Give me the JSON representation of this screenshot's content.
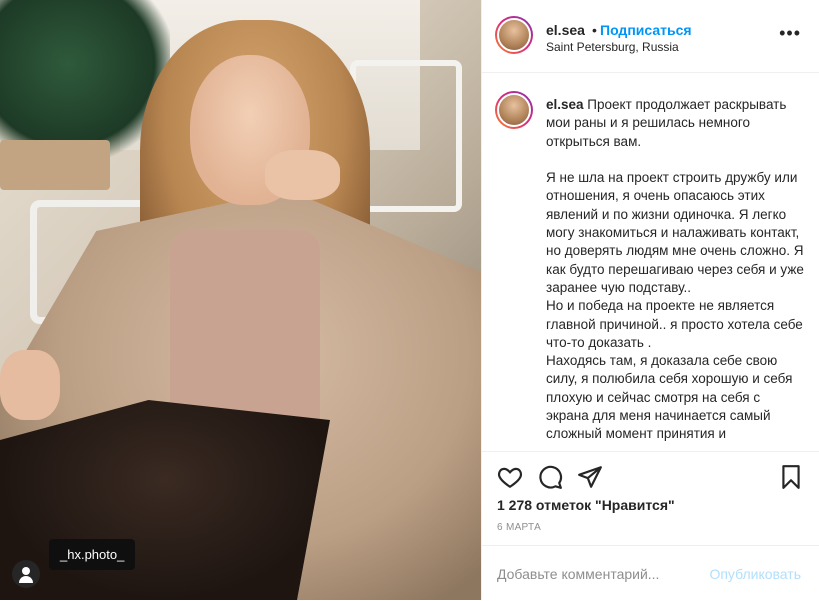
{
  "photo": {
    "tag_label": "_hx.photo_"
  },
  "header": {
    "username": "el.sea",
    "separator": "•",
    "follow_label": "Подписаться",
    "location": "Saint Petersburg, Russia",
    "more_icon": "more-options-icon"
  },
  "caption": {
    "username": "el.sea",
    "text": " Проект продолжает раскрывать мои раны и я решилась немного открыться вам.\n\nЯ не шла на проект строить дружбу или отношения, я очень опасаюсь этих явлений и по жизни одиночка. Я легко могу знакомиться и налаживать контакт, но доверять людям мне очень сложно. Я как будто перешагиваю через себя и уже заранее чую подставу..\nНо и победа на проекте не является главной причиной.. я просто хотела себе что-то доказать .\nНаходясь там, я доказала себе свою силу, я полюбила себя хорошую и себя плохую и сейчас смотря на себя с экрана для меня начинается самый сложный момент принятия и"
  },
  "actions": {
    "like_icon": "heart-icon",
    "comment_icon": "comment-icon",
    "share_icon": "share-icon",
    "save_icon": "bookmark-icon",
    "likes": "1 278 отметок \"Нравится\"",
    "date": "6 МАРТА"
  },
  "comment": {
    "placeholder": "Добавьте комментарий...",
    "publish_label": "Опубликовать"
  },
  "colors": {
    "accent": "#0095f6",
    "publish_disabled": "#b2dffc",
    "text": "#262626",
    "muted": "#8e8e8e"
  }
}
